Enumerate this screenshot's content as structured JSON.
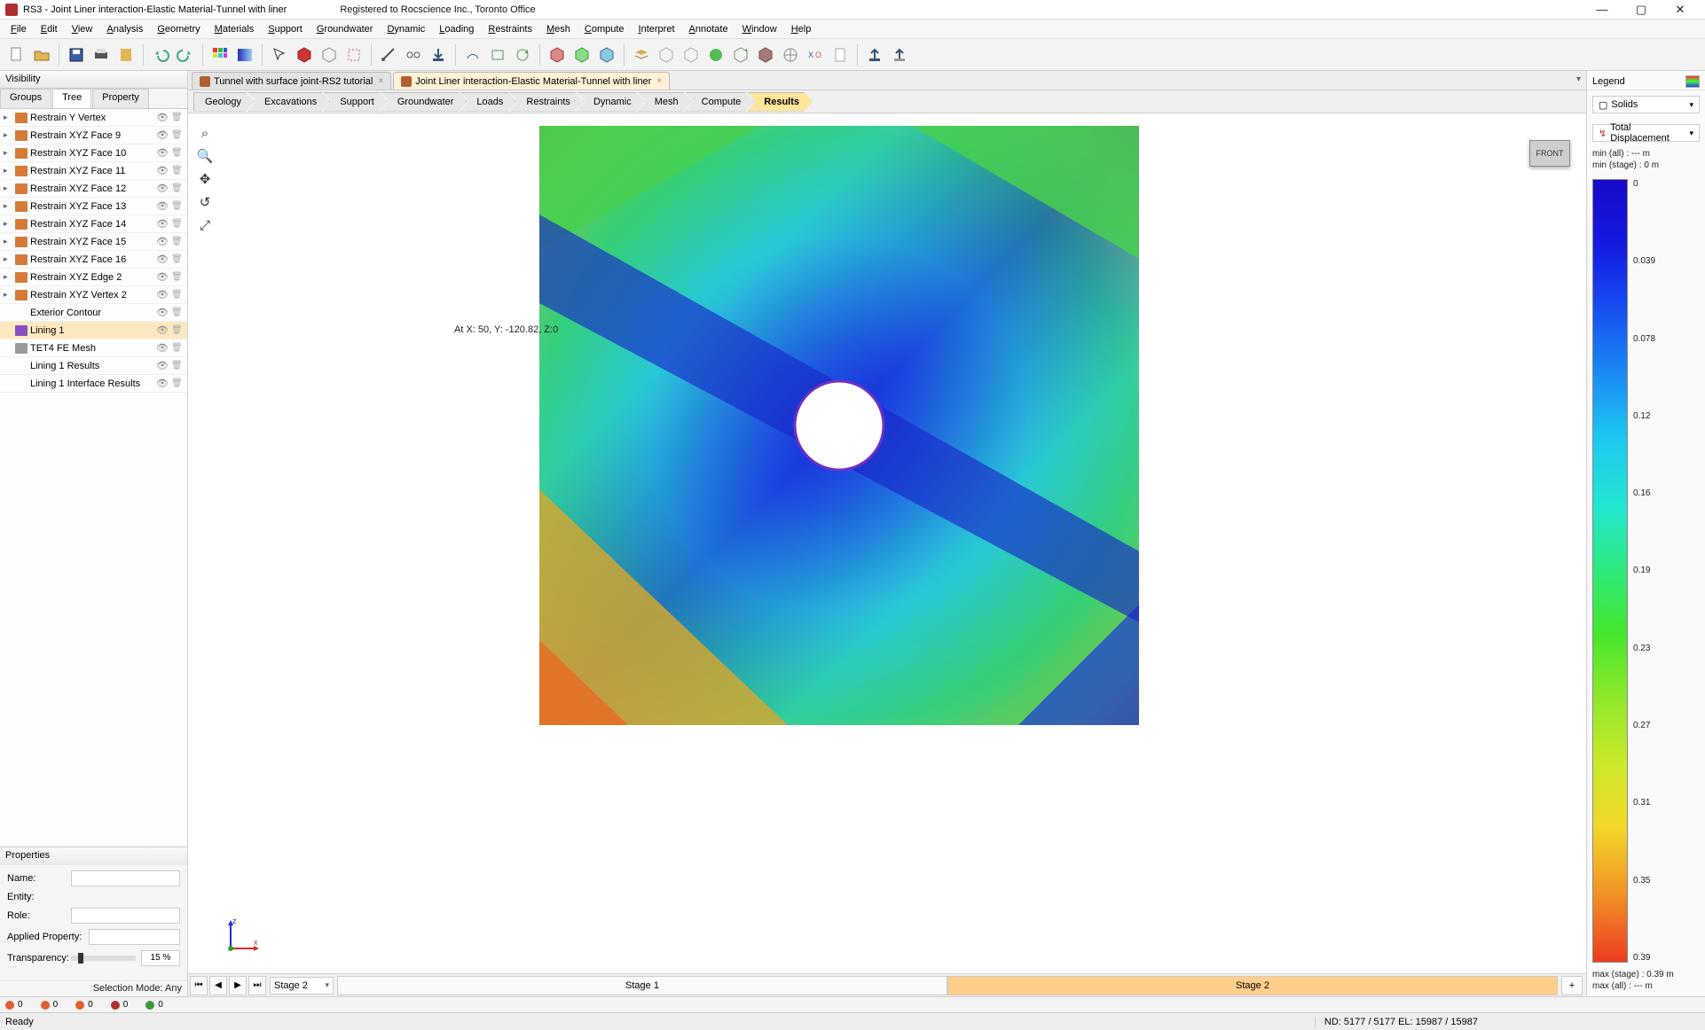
{
  "title": "RS3 - Joint Liner interaction-Elastic Material-Tunnel with liner",
  "registered": "Registered to Rocscience Inc., Toronto Office",
  "menu": [
    "File",
    "Edit",
    "View",
    "Analysis",
    "Geometry",
    "Materials",
    "Support",
    "Groundwater",
    "Dynamic",
    "Loading",
    "Restraints",
    "Mesh",
    "Compute",
    "Interpret",
    "Annotate",
    "Window",
    "Help"
  ],
  "visibility": {
    "panel_title": "Visibility",
    "tabs": [
      "Groups",
      "Tree",
      "Property"
    ],
    "active_tab": "Tree",
    "items": [
      {
        "label": "Restrain Y Vertex",
        "exp": true,
        "icon": "orange"
      },
      {
        "label": "Restrain XYZ Face 9",
        "exp": true,
        "icon": "orange"
      },
      {
        "label": "Restrain XYZ Face 10",
        "exp": true,
        "icon": "orange"
      },
      {
        "label": "Restrain XYZ Face 11",
        "exp": true,
        "icon": "orange"
      },
      {
        "label": "Restrain XYZ Face 12",
        "exp": true,
        "icon": "orange"
      },
      {
        "label": "Restrain XYZ Face 13",
        "exp": true,
        "icon": "orange"
      },
      {
        "label": "Restrain XYZ Face 14",
        "exp": true,
        "icon": "orange"
      },
      {
        "label": "Restrain XYZ Face 15",
        "exp": true,
        "icon": "orange"
      },
      {
        "label": "Restrain XYZ Face 16",
        "exp": true,
        "icon": "orange"
      },
      {
        "label": "Restrain XYZ Edge 2",
        "exp": true,
        "icon": "orange"
      },
      {
        "label": "Restrain XYZ Vertex 2",
        "exp": true,
        "icon": "orange"
      },
      {
        "label": "Exterior Contour",
        "exp": false,
        "icon": "none"
      },
      {
        "label": "Lining 1",
        "exp": false,
        "icon": "purple",
        "sel": true
      },
      {
        "label": "TET4 FE Mesh",
        "exp": false,
        "icon": "gray"
      },
      {
        "label": "Lining 1 Results",
        "exp": false,
        "icon": "none"
      },
      {
        "label": "Lining 1 Interface Results",
        "exp": false,
        "icon": "none"
      }
    ]
  },
  "props": {
    "title": "Properties",
    "name_label": "Name:",
    "entity_label": "Entity:",
    "role_label": "Role:",
    "applied_label": "Applied Property:",
    "trans_label": "Transparency:",
    "trans_val": "15 %"
  },
  "sel_mode": "Selection Mode: Any",
  "doctabs": [
    {
      "label": "Tunnel with surface joint-RS2 tutorial",
      "active": false
    },
    {
      "label": "Joint Liner interaction-Elastic Material-Tunnel with liner",
      "active": true
    }
  ],
  "workflow": [
    "Geology",
    "Excavations",
    "Support",
    "Groundwater",
    "Loads",
    "Restraints",
    "Dynamic",
    "Mesh",
    "Compute",
    "Results"
  ],
  "workflow_active": "Results",
  "viewport": {
    "cube": "FRONT",
    "coord": "At X: 50, Y: -120.82, Z:0",
    "triad": {
      "x": "x",
      "z": "z"
    }
  },
  "stages": {
    "current": "Stage 2",
    "list": [
      "Stage 1",
      "Stage 2"
    ],
    "active": "Stage 2",
    "add": "+"
  },
  "legend": {
    "title": "Legend",
    "solids": "Solids",
    "quantity": "Total Displacement",
    "min_all": "min (all) :    --- m",
    "min_stage": "min (stage) : 0 m",
    "max_stage": "max (stage) : 0.39 m",
    "max_all": "max (all) :    --- m",
    "ticks": [
      "0",
      "0.039",
      "0.078",
      "0.12",
      "0.16",
      "0.19",
      "0.23",
      "0.27",
      "0.31",
      "0.35",
      "0.39"
    ]
  },
  "counters": [
    {
      "color": "#e06030",
      "val": "0"
    },
    {
      "color": "#e06030",
      "val": "0"
    },
    {
      "color": "#e06030",
      "val": "0"
    },
    {
      "color": "#b03030",
      "val": "0"
    },
    {
      "color": "#3a9a3a",
      "val": "0"
    }
  ],
  "status": {
    "ready": "Ready",
    "nd": "ND: 5177 / 5177  EL: 15987 / 15987"
  }
}
